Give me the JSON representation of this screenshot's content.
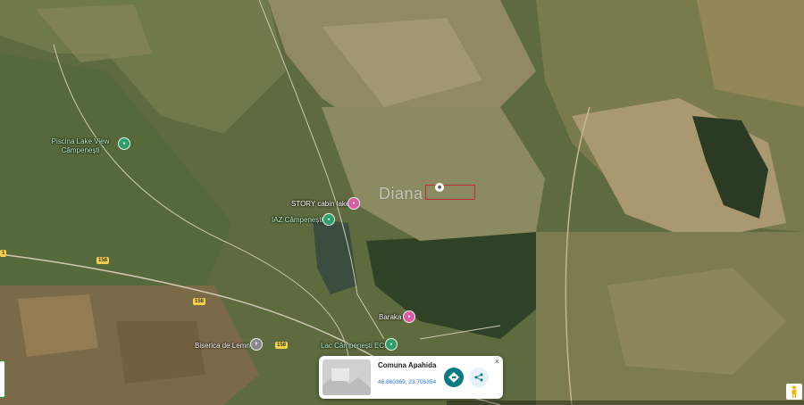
{
  "map": {
    "place_name": "Diana",
    "pois": [
      {
        "name": "Piscina Lake View Câmpenești",
        "icon": "pool-icon",
        "color": "#2e9e6a"
      },
      {
        "name": "STORY cabin lake",
        "icon": "hotel-icon",
        "color": "#d85ba5"
      },
      {
        "name": "IAZ Câmpenești",
        "icon": "lake-icon",
        "color": "#2e9e6a"
      },
      {
        "name": "Baraka",
        "icon": "hotel-icon",
        "color": "#d85ba5"
      },
      {
        "name": "Biserica de Lemn",
        "icon": "church-icon",
        "color": "#888888"
      },
      {
        "name": "Lac Câmpenești EC1",
        "icon": "lake-icon",
        "color": "#2e9e6a"
      }
    ],
    "road_shields": [
      "1",
      "158",
      "158",
      "158"
    ]
  },
  "info_card": {
    "title": "Comuna Apahida",
    "coordinates": "46.860369, 23.705354",
    "close_glyph": "×"
  }
}
